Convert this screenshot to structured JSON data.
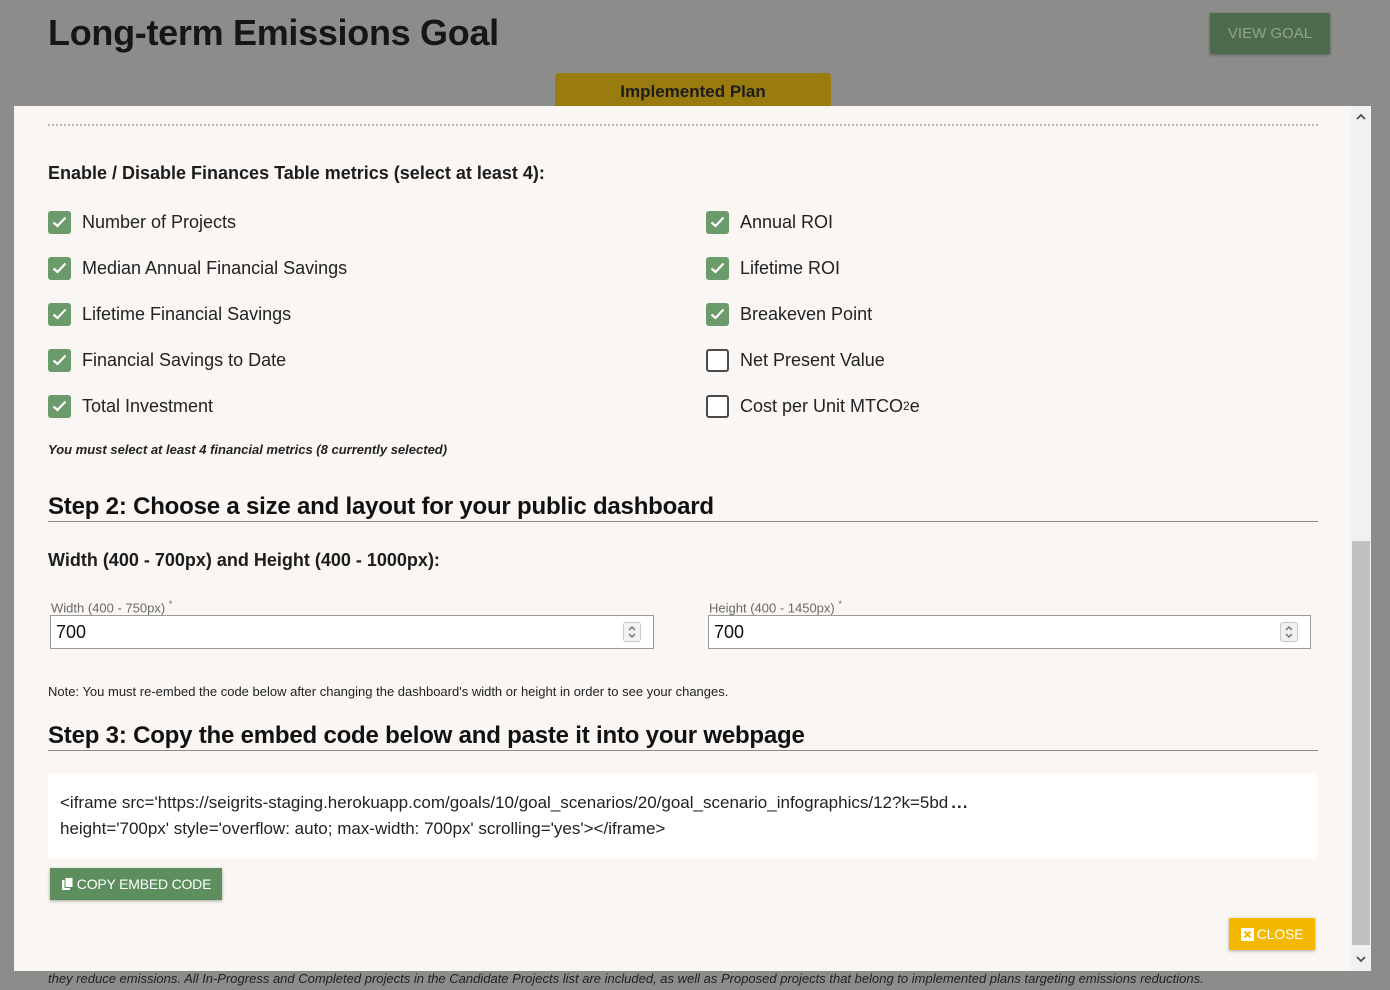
{
  "background": {
    "page_title": "Long-term Emissions Goal",
    "view_goal_label": "VIEW GOAL",
    "plan_tab_label": "Implemented Plan",
    "footer_text": "they reduce emissions. All In-Progress and Completed projects in the Candidate Projects list are included, as well as Proposed projects that belong to implemented plans targeting emissions reductions."
  },
  "modal": {
    "metrics_heading": "Enable / Disable Finances Table metrics (select at least 4):",
    "metrics_left": [
      {
        "label": "Number of Projects",
        "checked": true
      },
      {
        "label": "Median Annual Financial Savings",
        "checked": true
      },
      {
        "label": "Lifetime Financial Savings",
        "checked": true
      },
      {
        "label": "Financial Savings to Date",
        "checked": true
      },
      {
        "label": "Total Investment",
        "checked": true
      }
    ],
    "metrics_right": [
      {
        "label": "Annual ROI",
        "checked": true
      },
      {
        "label": "Lifetime ROI",
        "checked": true
      },
      {
        "label": "Breakeven Point",
        "checked": true
      },
      {
        "label": "Net Present Value",
        "checked": false
      },
      {
        "label": "Cost per Unit MTCO",
        "sub": "2",
        "suffix": "e",
        "checked": false
      }
    ],
    "metrics_hint": "You must select at least 4 financial metrics (8 currently selected)",
    "step2_heading": "Step 2: Choose a size and layout for your public dashboard",
    "size_heading": "Width (400 - 700px) and Height (400 - 1000px):",
    "width_label": "Width (400 - 750px)",
    "width_value": "700",
    "height_label": "Height (400 - 1450px)",
    "height_value": "700",
    "required_mark": "*",
    "note": "Note: You must re-embed the code below after changing the dashboard's width or height in order to see your changes.",
    "step3_heading": "Step 3: Copy the embed code below and paste it into your webpage",
    "embed_line1": "<iframe src='https://seigrits-staging.herokuapp.com/goals/10/goal_scenarios/20/goal_scenario_infographics/12?k=5bd",
    "embed_ellipsis": "...",
    "embed_line2": "height='700px' style='overflow: auto; max-width: 700px' scrolling='yes'></iframe>",
    "copy_button_label": "COPY EMBED CODE",
    "close_button_label": "CLOSE"
  },
  "colors": {
    "checkbox_checked": "#6b9a6b",
    "copy_button": "#5d8e5d",
    "close_button": "#f5b800",
    "plan_tab": "#9a7b10",
    "view_goal": "#4e6b4e"
  },
  "icons": {
    "copy": "copy-icon",
    "close": "close-square-icon",
    "check": "check-icon"
  }
}
